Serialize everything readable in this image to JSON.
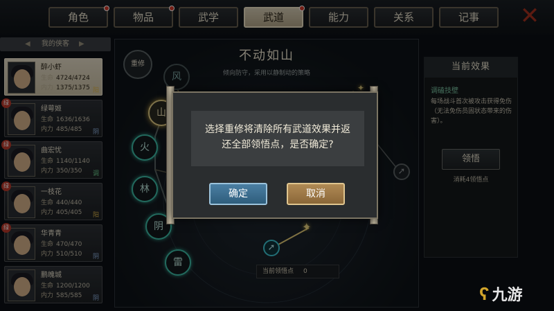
{
  "tabs": [
    {
      "label": "角色",
      "alert": true
    },
    {
      "label": "物品",
      "alert": true
    },
    {
      "label": "武学",
      "alert": false
    },
    {
      "label": "武道",
      "alert": true,
      "active": true
    },
    {
      "label": "能力",
      "alert": false
    },
    {
      "label": "关系",
      "alert": false
    },
    {
      "label": "记事",
      "alert": false
    }
  ],
  "roster": {
    "title": "我的侠客",
    "characters": [
      {
        "name": "醉小虾",
        "hp": "4724/4724",
        "mp": "1375/1375",
        "trait": "阳",
        "selected": true,
        "badge": ""
      },
      {
        "name": "绿萼姬",
        "hp": "1636/1636",
        "mp": "485/485",
        "trait": "阴",
        "selected": false,
        "badge": "绿"
      },
      {
        "name": "曲宏忧",
        "hp": "1140/1140",
        "mp": "350/350",
        "trait": "调",
        "selected": false,
        "badge": "绿"
      },
      {
        "name": "一枝花",
        "hp": "440/440",
        "mp": "405/405",
        "trait": "阳",
        "selected": false,
        "badge": "绿"
      },
      {
        "name": "华青青",
        "hp": "470/470",
        "mp": "510/510",
        "trait": "阴",
        "selected": false,
        "badge": "绿"
      },
      {
        "name": "鹏魄城",
        "hp": "1200/1200",
        "mp": "585/585",
        "trait": "阴",
        "selected": false,
        "badge": ""
      }
    ],
    "hp_label": "生命",
    "mp_label": "内力"
  },
  "center": {
    "title": "不动如山",
    "subtitle": "倾向防守，采用以静制动的策略",
    "reset_label": "重修",
    "nodes": [
      "风",
      "山",
      "火",
      "林",
      "阴",
      "雷"
    ],
    "points_label": "当前领悟点",
    "points_value": "0"
  },
  "right": {
    "title": "当前效果",
    "effect_name": "调磕技壁",
    "effect_desc": "每场战斗首次被攻击获得免伤（无法免伤员固状态带来的伤害）。",
    "learn_label": "领悟",
    "cost": "消耗4领悟点"
  },
  "modal": {
    "message_line1": "选择重修将清除所有武道效果并返",
    "message_line2": "还全部领悟点，是否确定?",
    "ok_label": "确定",
    "cancel_label": "取消"
  },
  "watermark": "九游",
  "colors": {
    "accent": "#e6cf88",
    "ok": "#3f7aa0",
    "cancel": "#a07a45",
    "close": "#a8321f"
  }
}
